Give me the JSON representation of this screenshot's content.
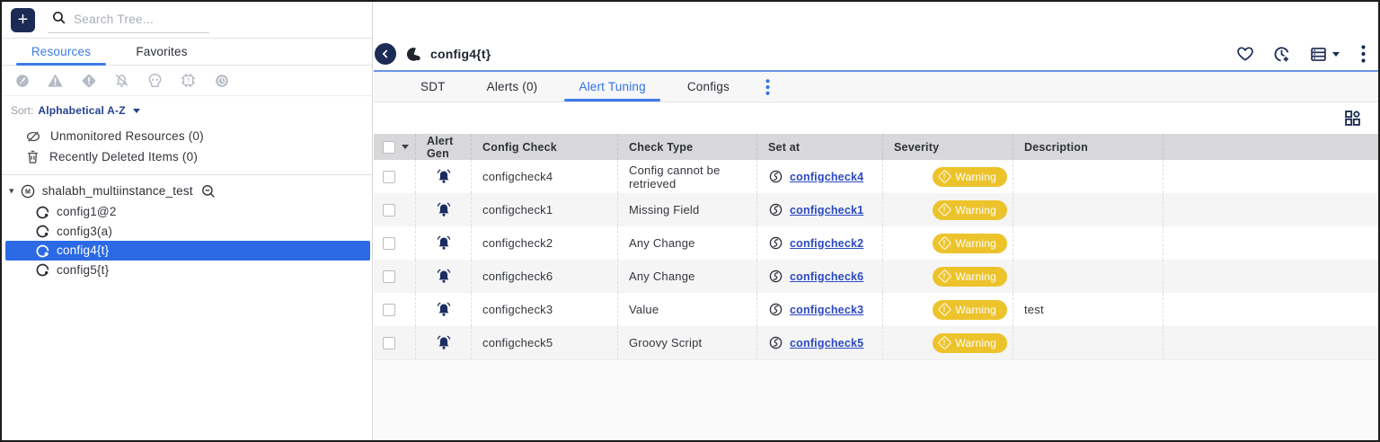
{
  "topbar": {
    "search_placeholder": "Search Tree..."
  },
  "sidebar": {
    "tabs": [
      {
        "label": "Resources",
        "active": true
      },
      {
        "label": "Favorites",
        "active": false
      }
    ],
    "filter_icons": [
      "alert-critical-icon",
      "alert-error-triangle-icon",
      "alert-warning-diamond-icon",
      "alerting-disabled-bell-slash-icon",
      "dead-skull-icon",
      "unmonitored-chip-icon",
      "sdt-clock-icon"
    ],
    "sort": {
      "label": "Sort:",
      "value": "Alphabetical A-Z"
    },
    "special_items": [
      {
        "label": "Unmonitored Resources (0)"
      },
      {
        "label": "Recently Deleted Items (0)"
      }
    ],
    "tree": {
      "parent_label": "shalabh_multiinstance_test",
      "children": [
        {
          "label": "config1@2",
          "selected": false
        },
        {
          "label": "config3(a)",
          "selected": false
        },
        {
          "label": "config4{t}",
          "selected": true
        },
        {
          "label": "config5{t}",
          "selected": false
        }
      ]
    }
  },
  "main": {
    "title": "config4{t}",
    "tabs": [
      {
        "label": "SDT",
        "active": false
      },
      {
        "label": "Alerts (0)",
        "active": false
      },
      {
        "label": "Alert Tuning",
        "active": true
      },
      {
        "label": "Configs",
        "active": false
      }
    ],
    "table": {
      "columns": {
        "alert_gen": "Alert Gen",
        "config_check": "Config Check",
        "check_type": "Check Type",
        "set_at": "Set at",
        "severity": "Severity",
        "description": "Description"
      },
      "rows": [
        {
          "config_check": "configcheck4",
          "check_type": "Config cannot be retrieved",
          "set_at": "configcheck4",
          "severity": "Warning",
          "description": ""
        },
        {
          "config_check": "configcheck1",
          "check_type": "Missing Field",
          "set_at": "configcheck1",
          "severity": "Warning",
          "description": ""
        },
        {
          "config_check": "configcheck2",
          "check_type": "Any Change",
          "set_at": "configcheck2",
          "severity": "Warning",
          "description": ""
        },
        {
          "config_check": "configcheck6",
          "check_type": "Any Change",
          "set_at": "configcheck6",
          "severity": "Warning",
          "description": ""
        },
        {
          "config_check": "configcheck3",
          "check_type": "Value",
          "set_at": "configcheck3",
          "severity": "Warning",
          "description": "test"
        },
        {
          "config_check": "configcheck5",
          "check_type": "Groovy Script",
          "set_at": "configcheck5",
          "severity": "Warning",
          "description": ""
        }
      ]
    }
  },
  "colors": {
    "navy": "#1b2b55",
    "accent_blue": "#3b7bea",
    "selected_blue": "#2b6ae4",
    "link_blue": "#2b49c0",
    "warning_yellow": "#edc32c",
    "header_gray": "#d8d8da"
  }
}
